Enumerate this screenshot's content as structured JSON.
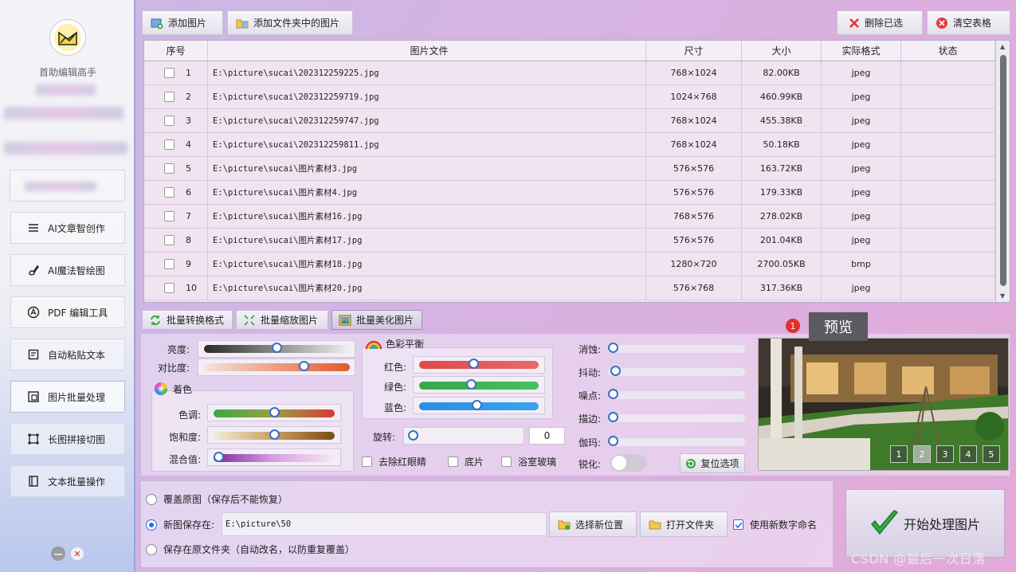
{
  "sidebar": {
    "app_name": "首助编辑高手",
    "items": [
      {
        "label": "AI文章智创作",
        "icon": "menu-lines-icon"
      },
      {
        "label": "AI魔法智绘图",
        "icon": "pen-brush-icon"
      },
      {
        "label": "PDF 编辑工具",
        "icon": "pdf-circle-icon"
      },
      {
        "label": "自动粘贴文本",
        "icon": "paste-doc-icon"
      },
      {
        "label": "图片批量处理",
        "icon": "image-batch-icon"
      },
      {
        "label": "长图拼接切图",
        "icon": "crop-corners-icon"
      },
      {
        "label": "文本批量操作",
        "icon": "book-icon"
      }
    ]
  },
  "toolbar": {
    "add_image": "添加图片",
    "add_folder": "添加文件夹中的图片",
    "delete_selected": "删除已选",
    "clear_table": "清空表格"
  },
  "table": {
    "headers": [
      "序号",
      "图片文件",
      "尺寸",
      "大小",
      "实际格式",
      "状态"
    ],
    "rows": [
      {
        "idx": "1",
        "file": "E:\\picture\\sucai\\202312259225.jpg",
        "size": "768×1024",
        "bytes": "82.00KB",
        "fmt": "jpeg",
        "status": ""
      },
      {
        "idx": "2",
        "file": "E:\\picture\\sucai\\202312259719.jpg",
        "size": "1024×768",
        "bytes": "460.99KB",
        "fmt": "jpeg",
        "status": ""
      },
      {
        "idx": "3",
        "file": "E:\\picture\\sucai\\202312259747.jpg",
        "size": "768×1024",
        "bytes": "455.38KB",
        "fmt": "jpeg",
        "status": ""
      },
      {
        "idx": "4",
        "file": "E:\\picture\\sucai\\202312259811.jpg",
        "size": "768×1024",
        "bytes": "50.18KB",
        "fmt": "jpeg",
        "status": ""
      },
      {
        "idx": "5",
        "file": "E:\\picture\\sucai\\图片素材3.jpg",
        "size": "576×576",
        "bytes": "163.72KB",
        "fmt": "jpeg",
        "status": ""
      },
      {
        "idx": "6",
        "file": "E:\\picture\\sucai\\图片素材4.jpg",
        "size": "576×576",
        "bytes": "179.33KB",
        "fmt": "jpeg",
        "status": ""
      },
      {
        "idx": "7",
        "file": "E:\\picture\\sucai\\图片素材16.jpg",
        "size": "768×576",
        "bytes": "278.02KB",
        "fmt": "jpeg",
        "status": ""
      },
      {
        "idx": "8",
        "file": "E:\\picture\\sucai\\图片素材17.jpg",
        "size": "576×576",
        "bytes": "201.04KB",
        "fmt": "jpeg",
        "status": ""
      },
      {
        "idx": "9",
        "file": "E:\\picture\\sucai\\图片素材18.jpg",
        "size": "1280×720",
        "bytes": "2700.05KB",
        "fmt": "bmp",
        "status": ""
      },
      {
        "idx": "10",
        "file": "E:\\picture\\sucai\\图片素材20.jpg",
        "size": "576×768",
        "bytes": "317.36KB",
        "fmt": "jpeg",
        "status": ""
      }
    ]
  },
  "tabs": [
    "批量转换格式",
    "批量缩放图片",
    "批量美化图片"
  ],
  "adjust": {
    "brightness": {
      "label": "亮度:",
      "value": 0.5
    },
    "contrast": {
      "label": "对比度:",
      "value": 0.7
    },
    "tint_group": "着色",
    "hue": {
      "label": "色调:",
      "value": 0.5
    },
    "saturation": {
      "label": "饱和度:",
      "value": 0.5
    },
    "mix": {
      "label": "混合值:",
      "value": 0.0
    },
    "color_balance_group": "色彩平衡",
    "red": {
      "label": "红色:",
      "value": 0.45
    },
    "green": {
      "label": "绿色:",
      "value": 0.43
    },
    "blue": {
      "label": "蓝色:",
      "value": 0.48
    },
    "rotate_label": "旋转:",
    "rotate_value": "0",
    "remove_redeye": "去除红眼睛",
    "negative": "底片",
    "frosted_glass": "浴室玻璃",
    "erode": {
      "label": "消蚀:",
      "value": 0.0
    },
    "jitter": {
      "label": "抖动:",
      "value": 0.02
    },
    "noise": {
      "label": "噪点:",
      "value": 0.0
    },
    "outline": {
      "label": "描边:",
      "value": 0.0
    },
    "gamma": {
      "label": "伽玛:",
      "value": 0.0
    },
    "sharpen": "锐化:",
    "reset": "复位选项"
  },
  "preview": {
    "tooltip": "预览",
    "badge": "1",
    "pages": [
      "1",
      "2",
      "3",
      "4",
      "5"
    ]
  },
  "save": {
    "overwrite": "覆盖原图（保存后不能恢复）",
    "new_path_label": "新图保存在:",
    "new_path_value": "E:\\picture\\50",
    "original_folder": "保存在原文件夹（自动改名，以防重复覆盖）",
    "choose_location": "选择新位置",
    "open_folder": "打开文件夹",
    "use_new_number": "使用新数字命名"
  },
  "start_button": "开始处理图片",
  "watermark": "CSDN @最后一次日落"
}
